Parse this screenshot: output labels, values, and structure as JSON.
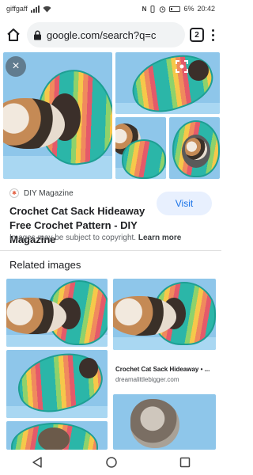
{
  "status_bar": {
    "carrier": "giffgaff",
    "battery": "6%",
    "time": "20:42",
    "status_icons": [
      "nfc-icon",
      "vibrate-icon",
      "alarm-icon",
      "signal-icon",
      "wifi-icon",
      "battery-icon"
    ]
  },
  "browser": {
    "url": "google.com/search?q=c",
    "tab_count": "2"
  },
  "result": {
    "source": "DIY Magazine",
    "title": "Crochet Cat Sack Hideaway Free Crochet Pattern - DIY Magazine",
    "visit_label": "Visit",
    "copyright_text": "Images may be subject to copyright.",
    "learn_more": "Learn more"
  },
  "related": {
    "heading": "Related images",
    "items": [
      {
        "title": "Crochet Cat Sack Hideaway • ...",
        "domain": "dreamalittlebigger.com"
      }
    ]
  },
  "nav_icons": [
    "back-icon",
    "home-circle-icon",
    "recents-square-icon"
  ]
}
